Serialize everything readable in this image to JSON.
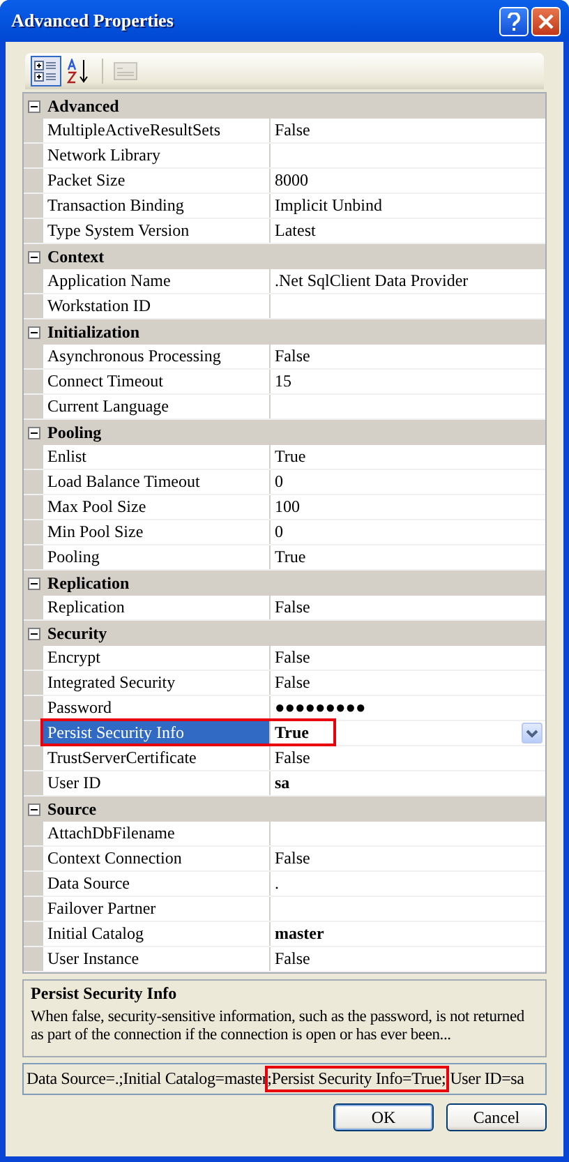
{
  "window": {
    "title": "Advanced Properties"
  },
  "toolbar": [
    {
      "kind": "categorized",
      "selected": true,
      "disabled": false
    },
    {
      "kind": "alphabetical",
      "selected": false,
      "disabled": false
    },
    {
      "kind": "pages",
      "selected": false,
      "disabled": true
    }
  ],
  "categories": [
    {
      "name": "Advanced",
      "expanded": true,
      "properties": [
        {
          "name": "MultipleActiveResultSets",
          "value": "False",
          "bold": false,
          "selected": false,
          "highlighted": false
        },
        {
          "name": "Network Library",
          "bold": false,
          "selected": false,
          "highlighted": false
        },
        {
          "name": "Packet Size",
          "value": "8000",
          "bold": false,
          "selected": false,
          "highlighted": false
        },
        {
          "name": "Transaction Binding",
          "value": "Implicit Unbind",
          "bold": false,
          "selected": false,
          "highlighted": false
        },
        {
          "name": "Type System Version",
          "value": "Latest",
          "bold": false,
          "selected": false,
          "highlighted": false
        }
      ]
    },
    {
      "name": "Context",
      "expanded": true,
      "properties": [
        {
          "name": "Application Name",
          "value": ".Net SqlClient Data Provider",
          "bold": false,
          "selected": false,
          "highlighted": false
        },
        {
          "name": "Workstation ID",
          "bold": false,
          "selected": false,
          "highlighted": false
        }
      ]
    },
    {
      "name": "Initialization",
      "expanded": true,
      "properties": [
        {
          "name": "Asynchronous Processing",
          "value": "False",
          "bold": false,
          "selected": false,
          "highlighted": false
        },
        {
          "name": "Connect Timeout",
          "value": "15",
          "bold": false,
          "selected": false,
          "highlighted": false
        },
        {
          "name": "Current Language",
          "bold": false,
          "selected": false,
          "highlighted": false
        }
      ]
    },
    {
      "name": "Pooling",
      "expanded": true,
      "properties": [
        {
          "name": "Enlist",
          "value": "True",
          "bold": false,
          "selected": false,
          "highlighted": false
        },
        {
          "name": "Load Balance Timeout",
          "value": "0",
          "bold": false,
          "selected": false,
          "highlighted": false
        },
        {
          "name": "Max Pool Size",
          "value": "100",
          "bold": false,
          "selected": false,
          "highlighted": false
        },
        {
          "name": "Min Pool Size",
          "value": "0",
          "bold": false,
          "selected": false,
          "highlighted": false
        },
        {
          "name": "Pooling",
          "value": "True",
          "bold": false,
          "selected": false,
          "highlighted": false
        }
      ]
    },
    {
      "name": "Replication",
      "expanded": true,
      "properties": [
        {
          "name": "Replication",
          "value": "False",
          "bold": false,
          "selected": false,
          "highlighted": false
        }
      ]
    },
    {
      "name": "Security",
      "expanded": true,
      "properties": [
        {
          "name": "Encrypt",
          "value": "False",
          "bold": false,
          "selected": false,
          "highlighted": false
        },
        {
          "name": "Integrated Security",
          "value": "False",
          "bold": false,
          "selected": false,
          "highlighted": false
        },
        {
          "name": "Password",
          "value": "●●●●●●●●●",
          "bold": false,
          "selected": false,
          "highlighted": false
        },
        {
          "name": "Persist Security Info",
          "value": "True",
          "bold": true,
          "selected": true,
          "highlighted": true
        },
        {
          "name": "TrustServerCertificate",
          "value": "False",
          "bold": false,
          "selected": false,
          "highlighted": false
        },
        {
          "name": "User ID",
          "value": "sa",
          "bold": true,
          "selected": false,
          "highlighted": false
        }
      ]
    },
    {
      "name": "Source",
      "expanded": true,
      "properties": [
        {
          "name": "AttachDbFilename",
          "bold": false,
          "selected": false,
          "highlighted": false
        },
        {
          "name": "Context Connection",
          "value": "False",
          "bold": false,
          "selected": false,
          "highlighted": false
        },
        {
          "name": "Data Source",
          "value": ".",
          "bold": false,
          "selected": false,
          "highlighted": false
        },
        {
          "name": "Failover Partner",
          "bold": false,
          "selected": false,
          "highlighted": false
        },
        {
          "name": "Initial Catalog",
          "value": "master",
          "bold": true,
          "selected": false,
          "highlighted": false
        },
        {
          "name": "User Instance",
          "value": "False",
          "bold": false,
          "selected": false,
          "highlighted": false
        }
      ]
    }
  ],
  "description": {
    "title": "Persist Security Info",
    "text": "When false, security-sensitive information, such as the password, is not returned as part of the connection if the connection is open or has ever been..."
  },
  "connection_string": [
    {
      "text": "Data Source=.;Initial Catalog=master",
      "highlighted": false
    },
    {
      "text": ";Persist Security Info=True;",
      "highlighted": true
    },
    {
      "text": "User ID=sa",
      "highlighted": false
    }
  ],
  "buttons": [
    {
      "label": "OK",
      "default": true
    },
    {
      "label": "Cancel",
      "default": false
    }
  ]
}
